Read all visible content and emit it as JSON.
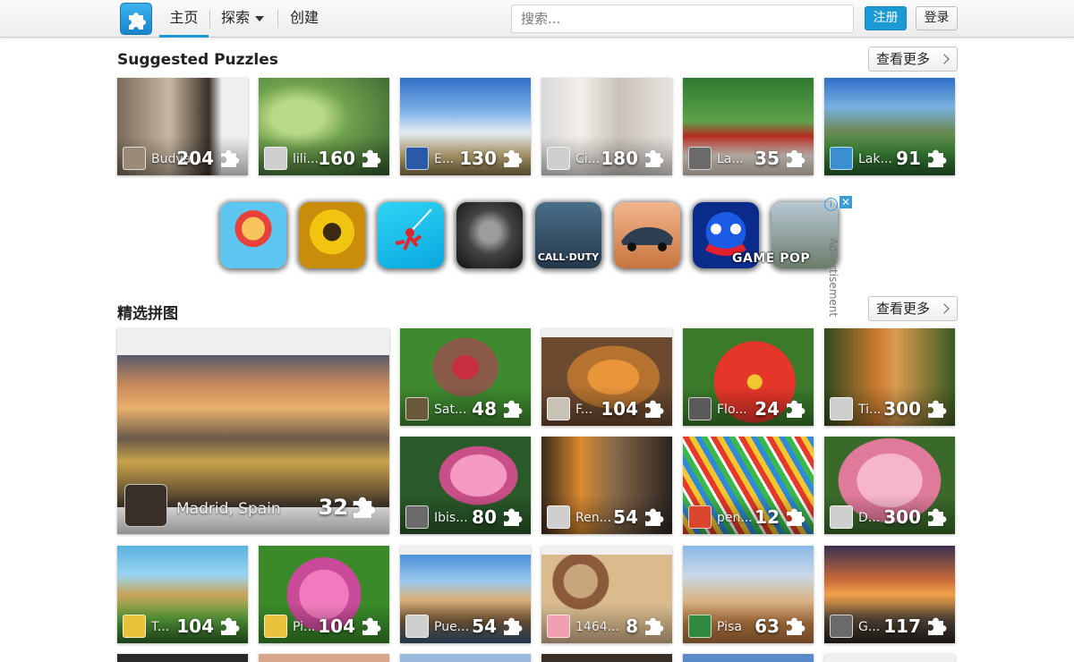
{
  "nav": {
    "home": "主页",
    "explore": "探索",
    "create": "创建",
    "search_placeholder": "搜索...",
    "register": "注册",
    "login": "登录"
  },
  "suggested": {
    "title": "Suggested Puzzles",
    "see_more": "查看更多",
    "cards": [
      {
        "name": "Budva...",
        "pieces": "204"
      },
      {
        "name": "lili...",
        "pieces": "160"
      },
      {
        "name": "E...",
        "pieces": "130"
      },
      {
        "name": "Ci...",
        "pieces": "180"
      },
      {
        "name": "La...",
        "pieces": "35"
      },
      {
        "name": "Lak...",
        "pieces": "91"
      }
    ]
  },
  "ad": {
    "label": "Advertisement",
    "info": "i",
    "close": "✕",
    "tiles": [
      "Subway Surfers",
      "Temple Run",
      "Stickman Hook",
      "Granny",
      "CALL·DUTY",
      "Car Racing",
      "Huggy",
      "PUBG"
    ],
    "call_duty_text": "CALL·DUTY",
    "brand": "GAME POP"
  },
  "featured": {
    "title": "精选拼图",
    "see_more": "查看更多",
    "big": {
      "name": "Madrid, Spain",
      "pieces": "32"
    },
    "cards": [
      {
        "name": "Sat...",
        "pieces": "48"
      },
      {
        "name": "F...",
        "pieces": "104"
      },
      {
        "name": "Flo...",
        "pieces": "24"
      },
      {
        "name": "Ti...",
        "pieces": "300"
      },
      {
        "name": "Ibis...",
        "pieces": "80"
      },
      {
        "name": "Ren...",
        "pieces": "54"
      },
      {
        "name": "pen...",
        "pieces": "12"
      },
      {
        "name": "D...",
        "pieces": "300"
      },
      {
        "name": "T...",
        "pieces": "104"
      },
      {
        "name": "Pi...",
        "pieces": "104"
      },
      {
        "name": "Pue...",
        "pieces": "54"
      },
      {
        "name": "1464...",
        "pieces": "8"
      },
      {
        "name": "Pisa",
        "pieces": "63"
      },
      {
        "name": "G...",
        "pieces": "117"
      }
    ]
  },
  "colors": {
    "accent": "#1c9ad6"
  }
}
